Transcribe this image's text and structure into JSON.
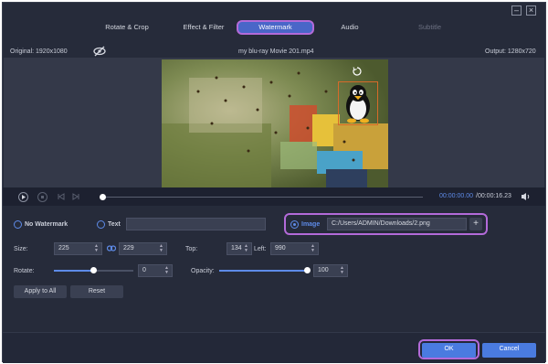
{
  "tabs": [
    {
      "label": "Rotate & Crop"
    },
    {
      "label": "Effect & Filter"
    },
    {
      "label": "Watermark"
    },
    {
      "label": "Audio"
    },
    {
      "label": "Subtitle"
    }
  ],
  "info": {
    "original": "Original: 1920x1080",
    "filename": "my blu-ray Movie 201.mp4",
    "output": "Output: 1280x720"
  },
  "timeline": {
    "current": "00:00:00.00",
    "total": "/00:00:16.23"
  },
  "watermark": {
    "no_watermark_label": "No Watermark",
    "text_label": "Text",
    "text_value": "",
    "image_label": "Image",
    "image_path": "C:/Users/ADMIN/Downloads/2.png",
    "add_glyph": "+"
  },
  "size": {
    "label": "Size:",
    "width": "225",
    "height": "229"
  },
  "position": {
    "top_label": "Top:",
    "top": "134",
    "left_label": "Left:",
    "left": "990"
  },
  "rotate": {
    "label": "Rotate:",
    "value": "0"
  },
  "opacity": {
    "label": "Opacity:",
    "value": "100"
  },
  "buttons": {
    "apply_all": "Apply to All",
    "reset": "Reset",
    "ok": "OK",
    "cancel": "Cancel"
  },
  "colors": {
    "accent": "#4a7be0",
    "highlight": "#b36ad9",
    "background": "#262b3a"
  },
  "icons": [
    "minimize-icon",
    "close-icon",
    "eye-off-icon",
    "rotate-icon",
    "play-icon",
    "stop-icon",
    "prev-icon",
    "next-icon",
    "volume-icon",
    "link-icon"
  ]
}
